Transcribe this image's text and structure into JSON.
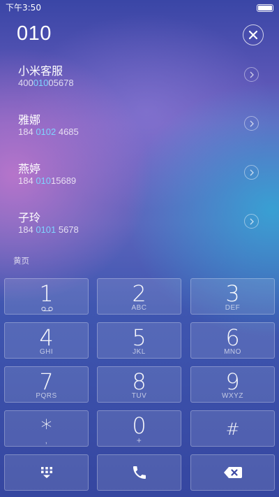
{
  "status_bar": {
    "time": "下午3:50"
  },
  "dialer": {
    "input": "010"
  },
  "contacts": [
    {
      "name": "小米客服",
      "number_before": "400",
      "number_match": "010",
      "number_after": "05678"
    },
    {
      "name": "雅娜",
      "number_before": "184 ",
      "number_match": "0102",
      "number_after": " 4685"
    },
    {
      "name": "燕婷",
      "number_before": "184 ",
      "number_match": "010",
      "number_after": "15689"
    },
    {
      "name": "子玲",
      "number_before": "184 ",
      "number_match": "0101",
      "number_after": " 5678"
    }
  ],
  "section_label": "黄页",
  "keypad": {
    "keys": [
      {
        "digit": "1",
        "sub": ""
      },
      {
        "digit": "2",
        "sub": "ABC"
      },
      {
        "digit": "3",
        "sub": "DEF"
      },
      {
        "digit": "4",
        "sub": "GHI"
      },
      {
        "digit": "5",
        "sub": "JKL"
      },
      {
        "digit": "6",
        "sub": "MNO"
      },
      {
        "digit": "7",
        "sub": "PQRS"
      },
      {
        "digit": "8",
        "sub": "TUV"
      },
      {
        "digit": "9",
        "sub": "WXYZ"
      },
      {
        "digit": "*",
        "sub": ","
      },
      {
        "digit": "0",
        "sub": "+"
      },
      {
        "digit": "#",
        "sub": ""
      }
    ]
  },
  "colors": {
    "match_highlight": "#7fd4ff",
    "key_fill": "rgba(255,255,255,0.12)"
  },
  "icons": {
    "key_1_sub": "voicemail-icon",
    "bottom_left": "dialpad-grid-icon",
    "bottom_center": "phone-icon",
    "bottom_right": "backspace-icon",
    "clear": "close-icon",
    "detail": "chevron-right-icon"
  }
}
